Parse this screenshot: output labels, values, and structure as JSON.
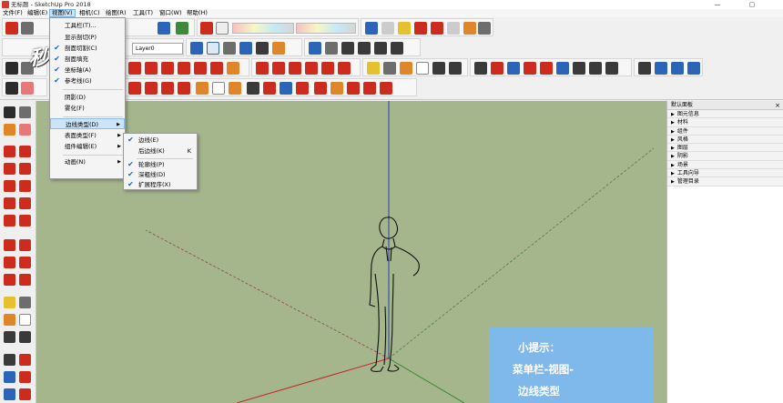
{
  "window": {
    "title": "无标题 - SketchUp Pro 2018",
    "minimize": "—",
    "maximize": "▢"
  },
  "menubar": [
    {
      "label": "文件(F)"
    },
    {
      "label": "编辑(E)"
    },
    {
      "label": "视图(V)"
    },
    {
      "label": "相机(C)"
    },
    {
      "label": "绘图(R)"
    },
    {
      "label": "工具(T)"
    },
    {
      "label": "窗口(W)"
    },
    {
      "label": "帮助(H)"
    }
  ],
  "toolbar": {
    "layer_value": "Layer0",
    "colors": {
      "red": "#cc2b1d",
      "blue": "#2c64b8",
      "green": "#3a8a3a",
      "orange": "#e0862a",
      "grey": "#6d6d6d",
      "yellow": "#e6c12f"
    }
  },
  "watermark": "秒懂视频",
  "view_menu": {
    "items": [
      {
        "label": "工具栏(T)...",
        "checked": false
      },
      {
        "label": "显示剖切(P)",
        "checked": false
      },
      {
        "label": "剖面切割(C)",
        "checked": true
      },
      {
        "label": "剖面填充",
        "checked": true
      },
      {
        "label": "坐标轴(A)",
        "checked": true
      },
      {
        "label": "参考线(G)",
        "checked": true
      },
      {
        "label": "阴影(D)",
        "checked": false
      },
      {
        "label": "雾化(F)",
        "checked": false
      },
      {
        "label": "边线类型(D)",
        "checked": false,
        "submenu": true,
        "highlighted": true
      },
      {
        "label": "表面类型(F)",
        "checked": false,
        "submenu": true
      },
      {
        "label": "组件编辑(E)",
        "checked": false,
        "submenu": true
      },
      {
        "label": "动画(N)",
        "checked": false,
        "submenu": true
      }
    ]
  },
  "edge_submenu": {
    "items": [
      {
        "label": "边线(E)",
        "checked": true,
        "key": ""
      },
      {
        "label": "后边线(K)",
        "checked": false,
        "key": "K"
      },
      {
        "label": "轮廓线(P)",
        "checked": true,
        "key": ""
      },
      {
        "label": "深粗线(D)",
        "checked": false,
        "key": ""
      },
      {
        "label": "扩展程序(X)",
        "checked": false,
        "key": ""
      }
    ]
  },
  "tray": {
    "title": "默认面板",
    "close": "×",
    "items": [
      "图元信息",
      "材料",
      "组件",
      "风格",
      "图层",
      "阴影",
      "场景",
      "工具向导",
      "管理目录"
    ]
  },
  "tip": {
    "title": "小提示：",
    "line1": "菜单栏-视图-",
    "line2": "边线类型"
  }
}
